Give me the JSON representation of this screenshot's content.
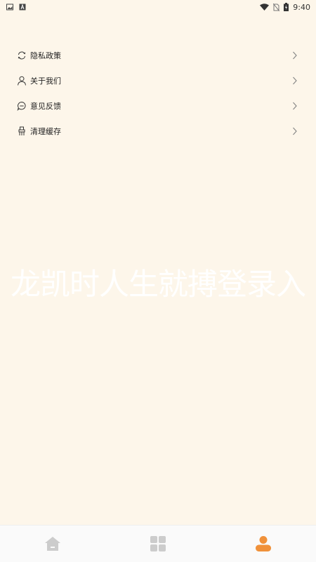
{
  "statusbar": {
    "time": "9:40",
    "icons": [
      "gallery-icon",
      "a-icon",
      "wifi-icon",
      "no-sim-icon",
      "battery-charging-icon"
    ]
  },
  "menu": {
    "items": [
      {
        "label": "隐私政策",
        "icon": "refresh-icon"
      },
      {
        "label": "关于我们",
        "icon": "person-icon"
      },
      {
        "label": "意见反馈",
        "icon": "feedback-icon"
      },
      {
        "label": "清理缓存",
        "icon": "clean-icon"
      }
    ]
  },
  "watermark": "龙凯时人生就搏登录入",
  "tabbar": {
    "tabs": [
      {
        "icon": "home-icon",
        "active": false
      },
      {
        "icon": "grid-icon",
        "active": false
      },
      {
        "icon": "user-icon",
        "active": true
      }
    ]
  },
  "colors": {
    "background": "#fdf6ea",
    "accent": "#f0913a",
    "inactive": "#cccccc"
  }
}
